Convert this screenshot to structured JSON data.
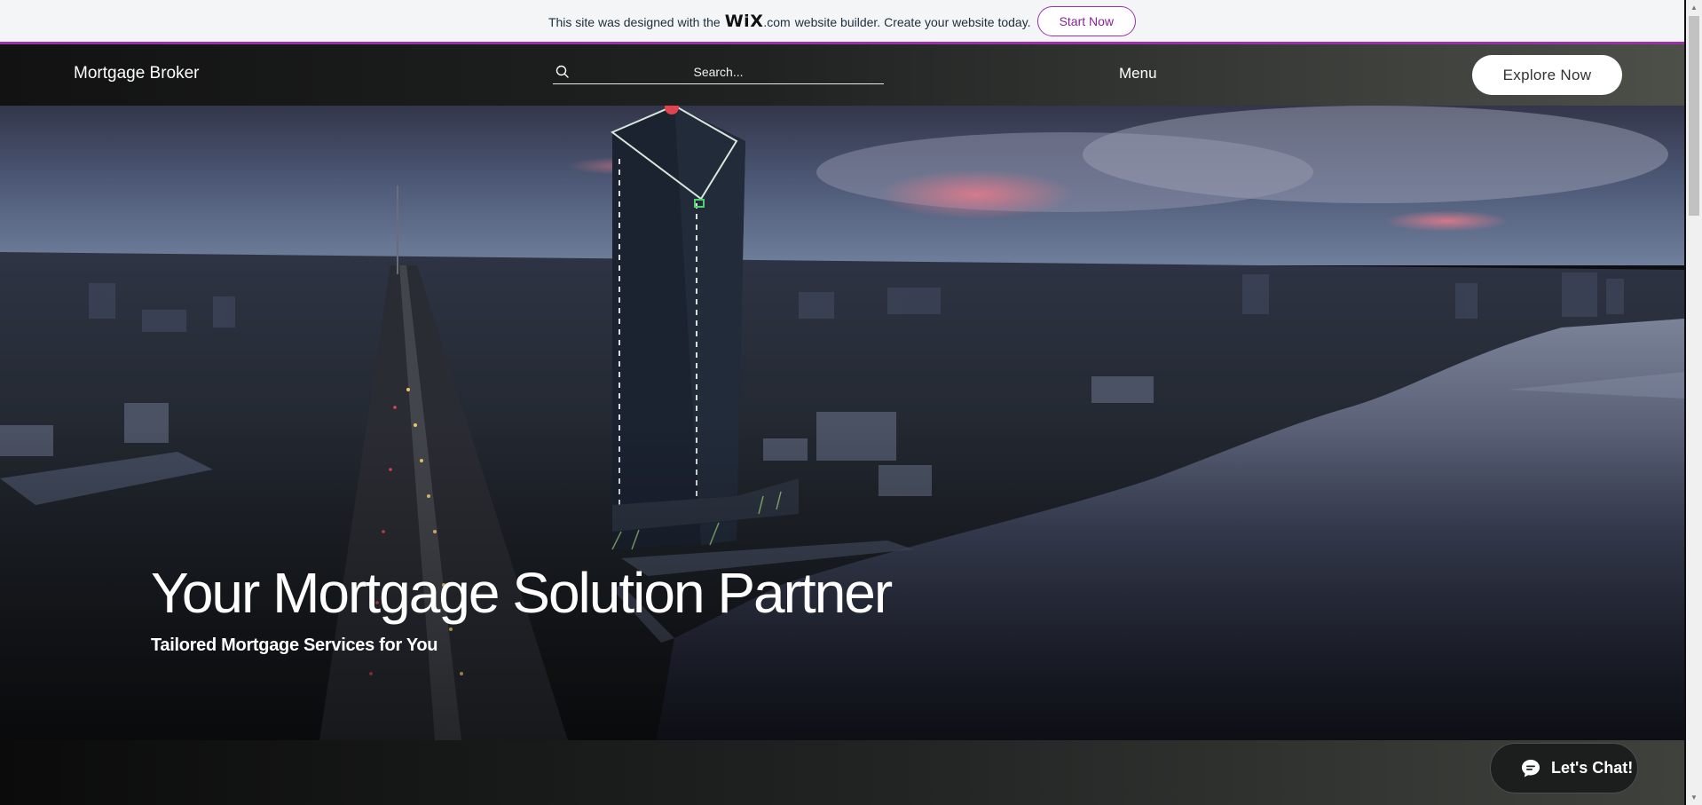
{
  "promo_banner": {
    "text_before": "This site was designed with the",
    "wix_logo": "WiX",
    "wix_tld": ".com",
    "text_after": "website builder. Create your website today.",
    "start_now": "Start Now",
    "accent": "#9b2fae"
  },
  "header": {
    "brand": "Mortgage Broker",
    "search_placeholder": "Search...",
    "search_icon": "search-icon",
    "menu": "Menu",
    "explore": "Explore Now"
  },
  "hero": {
    "title": "Your Mortgage Solution Partner",
    "subtitle": "Tailored Mortgage Services for You",
    "image": "aerial city skyline at dusk with river and tower"
  },
  "chat": {
    "label": "Let's Chat!",
    "icon": "chat-bubble-icon"
  }
}
